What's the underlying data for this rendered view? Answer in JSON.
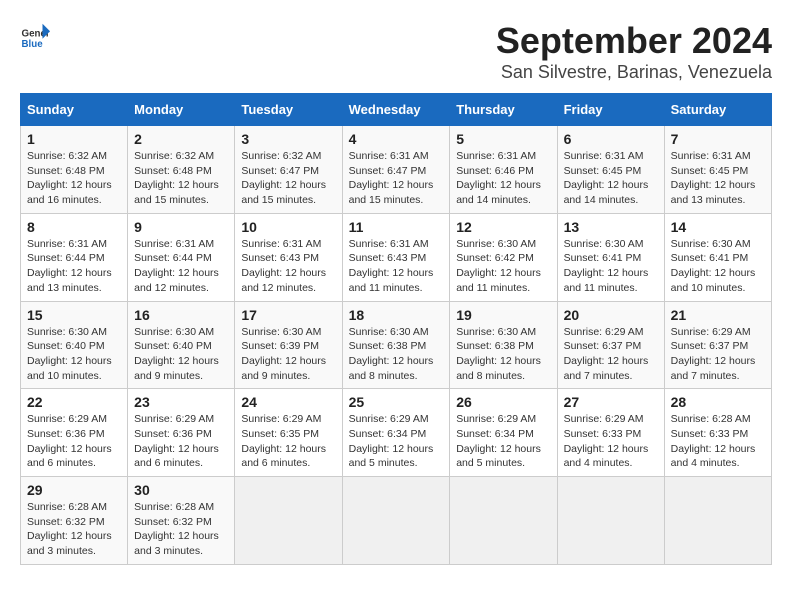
{
  "logo": {
    "line1": "General",
    "line2": "Blue"
  },
  "title": "September 2024",
  "subtitle": "San Silvestre, Barinas, Venezuela",
  "columns": [
    "Sunday",
    "Monday",
    "Tuesday",
    "Wednesday",
    "Thursday",
    "Friday",
    "Saturday"
  ],
  "rows": [
    [
      {
        "day": "1",
        "sunrise": "6:32 AM",
        "sunset": "6:48 PM",
        "daylight": "12 hours and 16 minutes."
      },
      {
        "day": "2",
        "sunrise": "6:32 AM",
        "sunset": "6:48 PM",
        "daylight": "12 hours and 15 minutes."
      },
      {
        "day": "3",
        "sunrise": "6:32 AM",
        "sunset": "6:47 PM",
        "daylight": "12 hours and 15 minutes."
      },
      {
        "day": "4",
        "sunrise": "6:31 AM",
        "sunset": "6:47 PM",
        "daylight": "12 hours and 15 minutes."
      },
      {
        "day": "5",
        "sunrise": "6:31 AM",
        "sunset": "6:46 PM",
        "daylight": "12 hours and 14 minutes."
      },
      {
        "day": "6",
        "sunrise": "6:31 AM",
        "sunset": "6:45 PM",
        "daylight": "12 hours and 14 minutes."
      },
      {
        "day": "7",
        "sunrise": "6:31 AM",
        "sunset": "6:45 PM",
        "daylight": "12 hours and 13 minutes."
      }
    ],
    [
      {
        "day": "8",
        "sunrise": "6:31 AM",
        "sunset": "6:44 PM",
        "daylight": "12 hours and 13 minutes."
      },
      {
        "day": "9",
        "sunrise": "6:31 AM",
        "sunset": "6:44 PM",
        "daylight": "12 hours and 12 minutes."
      },
      {
        "day": "10",
        "sunrise": "6:31 AM",
        "sunset": "6:43 PM",
        "daylight": "12 hours and 12 minutes."
      },
      {
        "day": "11",
        "sunrise": "6:31 AM",
        "sunset": "6:43 PM",
        "daylight": "12 hours and 11 minutes."
      },
      {
        "day": "12",
        "sunrise": "6:30 AM",
        "sunset": "6:42 PM",
        "daylight": "12 hours and 11 minutes."
      },
      {
        "day": "13",
        "sunrise": "6:30 AM",
        "sunset": "6:41 PM",
        "daylight": "12 hours and 11 minutes."
      },
      {
        "day": "14",
        "sunrise": "6:30 AM",
        "sunset": "6:41 PM",
        "daylight": "12 hours and 10 minutes."
      }
    ],
    [
      {
        "day": "15",
        "sunrise": "6:30 AM",
        "sunset": "6:40 PM",
        "daylight": "12 hours and 10 minutes."
      },
      {
        "day": "16",
        "sunrise": "6:30 AM",
        "sunset": "6:40 PM",
        "daylight": "12 hours and 9 minutes."
      },
      {
        "day": "17",
        "sunrise": "6:30 AM",
        "sunset": "6:39 PM",
        "daylight": "12 hours and 9 minutes."
      },
      {
        "day": "18",
        "sunrise": "6:30 AM",
        "sunset": "6:38 PM",
        "daylight": "12 hours and 8 minutes."
      },
      {
        "day": "19",
        "sunrise": "6:30 AM",
        "sunset": "6:38 PM",
        "daylight": "12 hours and 8 minutes."
      },
      {
        "day": "20",
        "sunrise": "6:29 AM",
        "sunset": "6:37 PM",
        "daylight": "12 hours and 7 minutes."
      },
      {
        "day": "21",
        "sunrise": "6:29 AM",
        "sunset": "6:37 PM",
        "daylight": "12 hours and 7 minutes."
      }
    ],
    [
      {
        "day": "22",
        "sunrise": "6:29 AM",
        "sunset": "6:36 PM",
        "daylight": "12 hours and 6 minutes."
      },
      {
        "day": "23",
        "sunrise": "6:29 AM",
        "sunset": "6:36 PM",
        "daylight": "12 hours and 6 minutes."
      },
      {
        "day": "24",
        "sunrise": "6:29 AM",
        "sunset": "6:35 PM",
        "daylight": "12 hours and 6 minutes."
      },
      {
        "day": "25",
        "sunrise": "6:29 AM",
        "sunset": "6:34 PM",
        "daylight": "12 hours and 5 minutes."
      },
      {
        "day": "26",
        "sunrise": "6:29 AM",
        "sunset": "6:34 PM",
        "daylight": "12 hours and 5 minutes."
      },
      {
        "day": "27",
        "sunrise": "6:29 AM",
        "sunset": "6:33 PM",
        "daylight": "12 hours and 4 minutes."
      },
      {
        "day": "28",
        "sunrise": "6:28 AM",
        "sunset": "6:33 PM",
        "daylight": "12 hours and 4 minutes."
      }
    ],
    [
      {
        "day": "29",
        "sunrise": "6:28 AM",
        "sunset": "6:32 PM",
        "daylight": "12 hours and 3 minutes."
      },
      {
        "day": "30",
        "sunrise": "6:28 AM",
        "sunset": "6:32 PM",
        "daylight": "12 hours and 3 minutes."
      },
      null,
      null,
      null,
      null,
      null
    ]
  ]
}
